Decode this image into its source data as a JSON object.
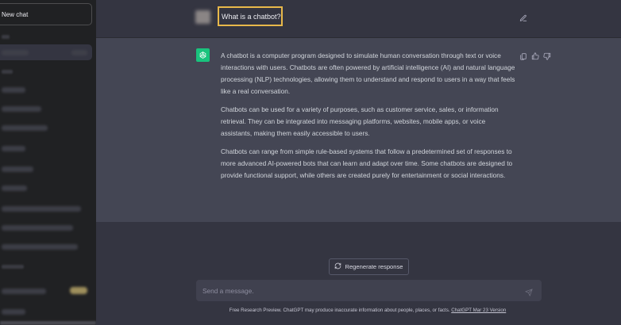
{
  "sidebar": {
    "new_chat_label": "New chat"
  },
  "conversation": {
    "question": "What is a chatbot?",
    "answer": [
      "A chatbot is a computer program designed to simulate human conversation through text or voice interactions with users. Chatbots are often powered by artificial intelligence (AI) and natural language processing (NLP) technologies, allowing them to understand and respond to users in a way that feels like a real conversation.",
      "Chatbots can be used for a variety of purposes, such as customer service, sales, or information retrieval. They can be integrated into messaging platforms, websites, mobile apps, or voice assistants, making them easily accessible to users.",
      "Chatbots can range from simple rule-based systems that follow a predetermined set of responses to more advanced AI-powered bots that can learn and adapt over time. Some chatbots are designed to provide functional support, while others are created purely for entertainment or social interactions."
    ]
  },
  "composer": {
    "regenerate_label": "Regenerate response",
    "placeholder": "Send a message."
  },
  "footer": {
    "text": "Free Research Preview. ChatGPT may produce inaccurate information about people, places, or facts. ",
    "link": "ChatGPT Mar 23 Version"
  },
  "colors": {
    "sidebar_bg": "#202123",
    "main_bg": "#343541",
    "answer_bg": "#444654",
    "accent_green": "#19c37d",
    "highlight": "#e8b84a"
  },
  "icons": [
    "edit-icon",
    "openai-logo-icon",
    "copy-icon",
    "thumbs-up-icon",
    "thumbs-down-icon",
    "refresh-icon",
    "send-icon"
  ]
}
